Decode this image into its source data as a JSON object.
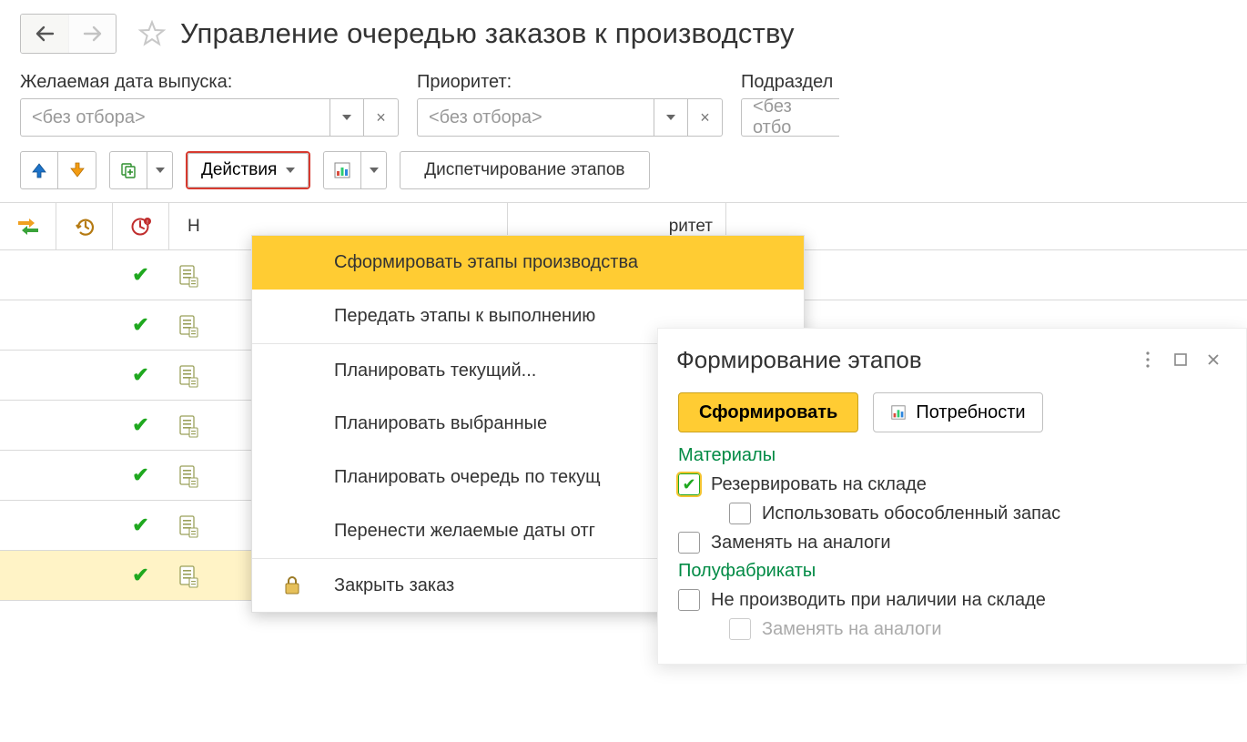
{
  "header": {
    "title": "Управление очередью заказов к производству"
  },
  "filters": {
    "date": {
      "label": "Желаемая дата выпуска:",
      "value": "<без отбора>"
    },
    "priority": {
      "label": "Приоритет:",
      "value": "<без отбора>"
    },
    "division": {
      "label": "Подраздел",
      "value": "<без отбо"
    }
  },
  "toolbar": {
    "actions_label": "Действия",
    "dispatch_label": "Диспетчирование этапов"
  },
  "columns": {
    "col_d": "Н",
    "col_e_partial": "ритет",
    "col_f": ""
  },
  "dropdown": {
    "items": [
      "Сформировать этапы производства",
      "Передать этапы к выполнению",
      "Планировать текущий...",
      "Планировать выбранные",
      "Планировать очередь по текущ",
      "Перенести желаемые даты отг",
      "Закрыть заказ"
    ]
  },
  "rows_count": 7,
  "popup": {
    "title": "Формирование этапов",
    "submit": "Сформировать",
    "needs": "Потребности",
    "section_materials": "Материалы",
    "chk_reserve": "Резервировать на складе",
    "chk_isolated": "Использовать обособленный запас",
    "chk_analog1": "Заменять на аналоги",
    "section_semi": "Полуфабрикаты",
    "chk_noproduce": "Не производить при наличии на складе",
    "chk_analog2": "Заменять на аналоги"
  }
}
